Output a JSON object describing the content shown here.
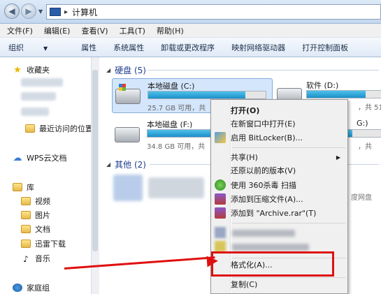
{
  "address": {
    "separator": "▸",
    "path": "计算机"
  },
  "menubar": [
    "文件(F)",
    "编辑(E)",
    "查看(V)",
    "工具(T)",
    "帮助(H)"
  ],
  "commandbar": {
    "organize": "组织",
    "items": [
      "属性",
      "系统属性",
      "卸载或更改程序",
      "映射网络驱动器",
      "打开控制面板"
    ]
  },
  "sidebar": {
    "favorites": "收藏夹",
    "recent": "最近访问的位置",
    "wps": "WPS云文档",
    "library": "库",
    "videos": "视频",
    "pictures": "图片",
    "documents": "文档",
    "xunlei": "迅雷下载",
    "music": "音乐",
    "homegroup": "家庭组"
  },
  "main": {
    "hard_disks_header": "硬盘 (5)",
    "other_header": "其他 (2)",
    "drive_c": {
      "name": "本地磁盘 (C:)",
      "free": "25.7 GB 可用，共",
      "fill": 0.83
    },
    "drive_d": {
      "name": "软件 (D:)",
      "free": "，共 51.",
      "fill": 0.78
    },
    "drive_f": {
      "name": "本地磁盘 (F:)",
      "free": "34.8 GB 可用，共",
      "fill": 0.55
    },
    "drive_g": {
      "name": "G:)",
      "free": "，共",
      "fill": 0.6
    },
    "netdisk": "度网盘"
  },
  "context_menu": {
    "open": "打开(O)",
    "open_new_window": "在新窗口中打开(E)",
    "bitlocker": "启用 BitLocker(B)...",
    "share": "共享(H)",
    "restore": "还原以前的版本(V)",
    "scan360": "使用 360杀毒 扫描",
    "add_zip": "添加到压缩文件(A)...",
    "add_rar": "添加到 \"Archive.rar\"(T)",
    "format": "格式化(A)...",
    "copy": "复制(C)"
  },
  "colors": {
    "highlight": "#e01010",
    "link": "#1e3d8f"
  }
}
